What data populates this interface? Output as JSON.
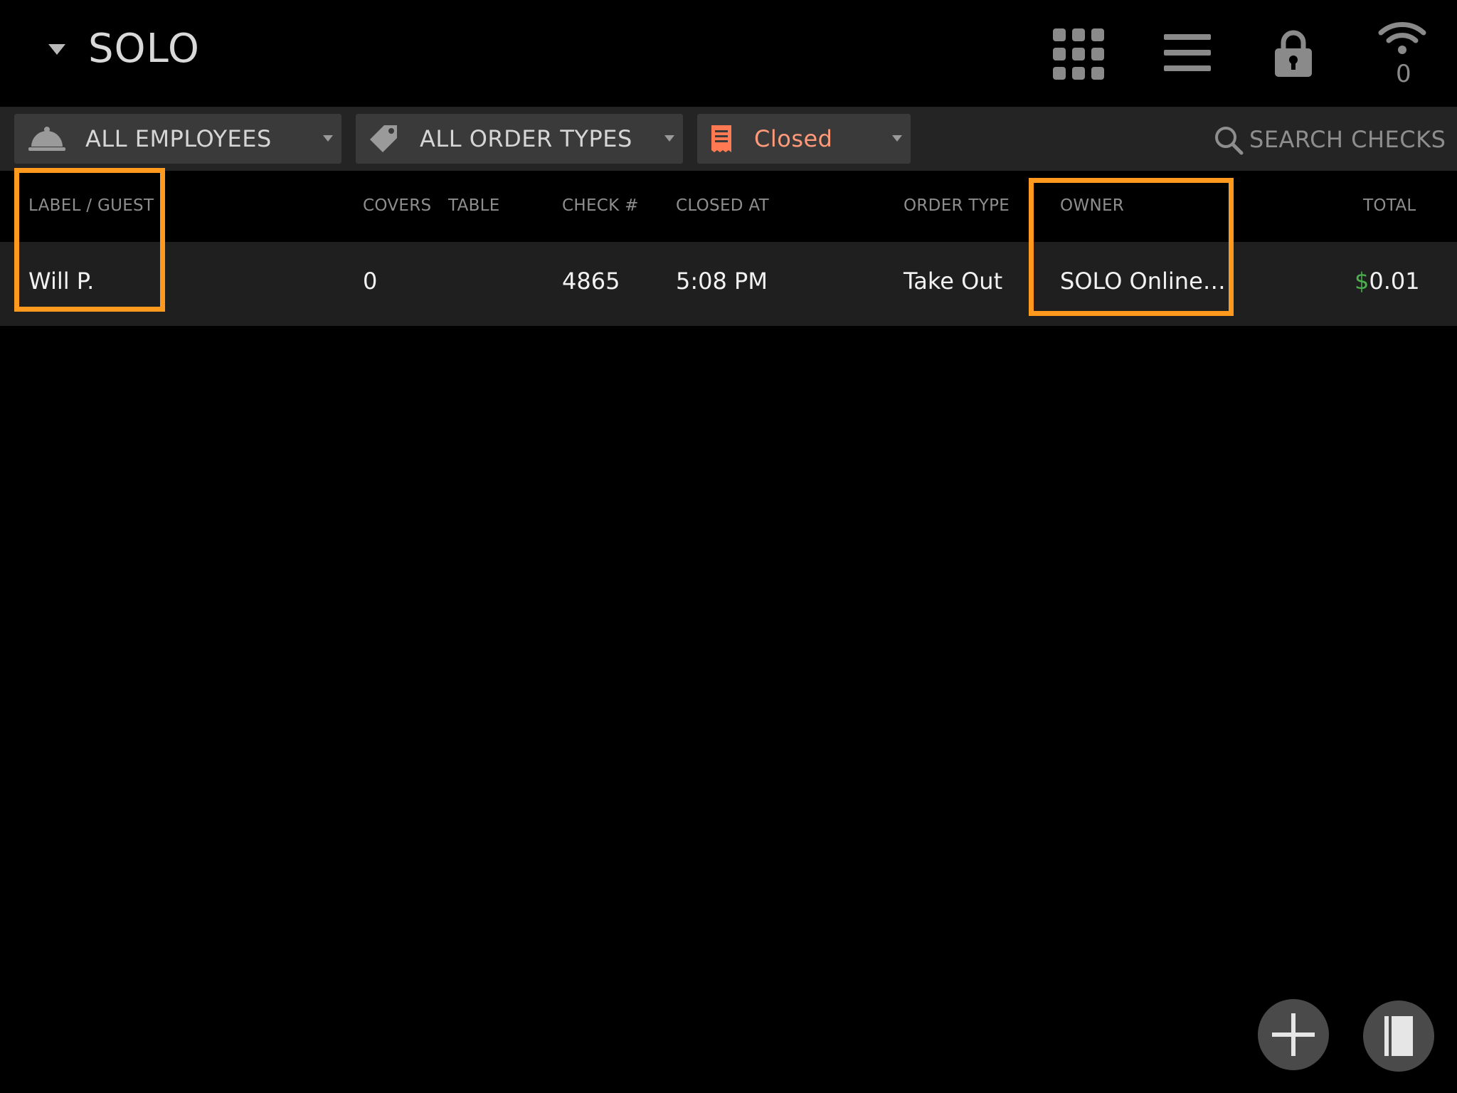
{
  "header": {
    "venue_name": "SOLO",
    "offline_count": "0",
    "icons": [
      "chevron-down-icon",
      "apps-grid-icon",
      "menu-icon",
      "lock-icon",
      "wifi-icon"
    ]
  },
  "filters": {
    "employees_label": "ALL EMPLOYEES",
    "order_types_label": "ALL ORDER TYPES",
    "status_label": "Closed",
    "search_placeholder": "SEARCH CHECKS"
  },
  "table": {
    "columns": [
      "LABEL / GUEST",
      "COVERS",
      "TABLE",
      "CHECK #",
      "CLOSED AT",
      "ORDER TYPE",
      "OWNER",
      "TOTAL"
    ],
    "rows": [
      {
        "guest": "Will P.",
        "covers": "0",
        "table": "",
        "check": "4865",
        "closed_at": "5:08 PM",
        "order_type": "Take Out",
        "owner": "SOLO Online…",
        "currency": "$",
        "total": "0.01"
      }
    ]
  },
  "colors": {
    "background": "#000000",
    "filter_bar": "#242424",
    "filter_button": "#3a3a3a",
    "status_accent": "#ff9b7a",
    "highlight": "#ff9a1f",
    "currency": "#4caf50"
  }
}
